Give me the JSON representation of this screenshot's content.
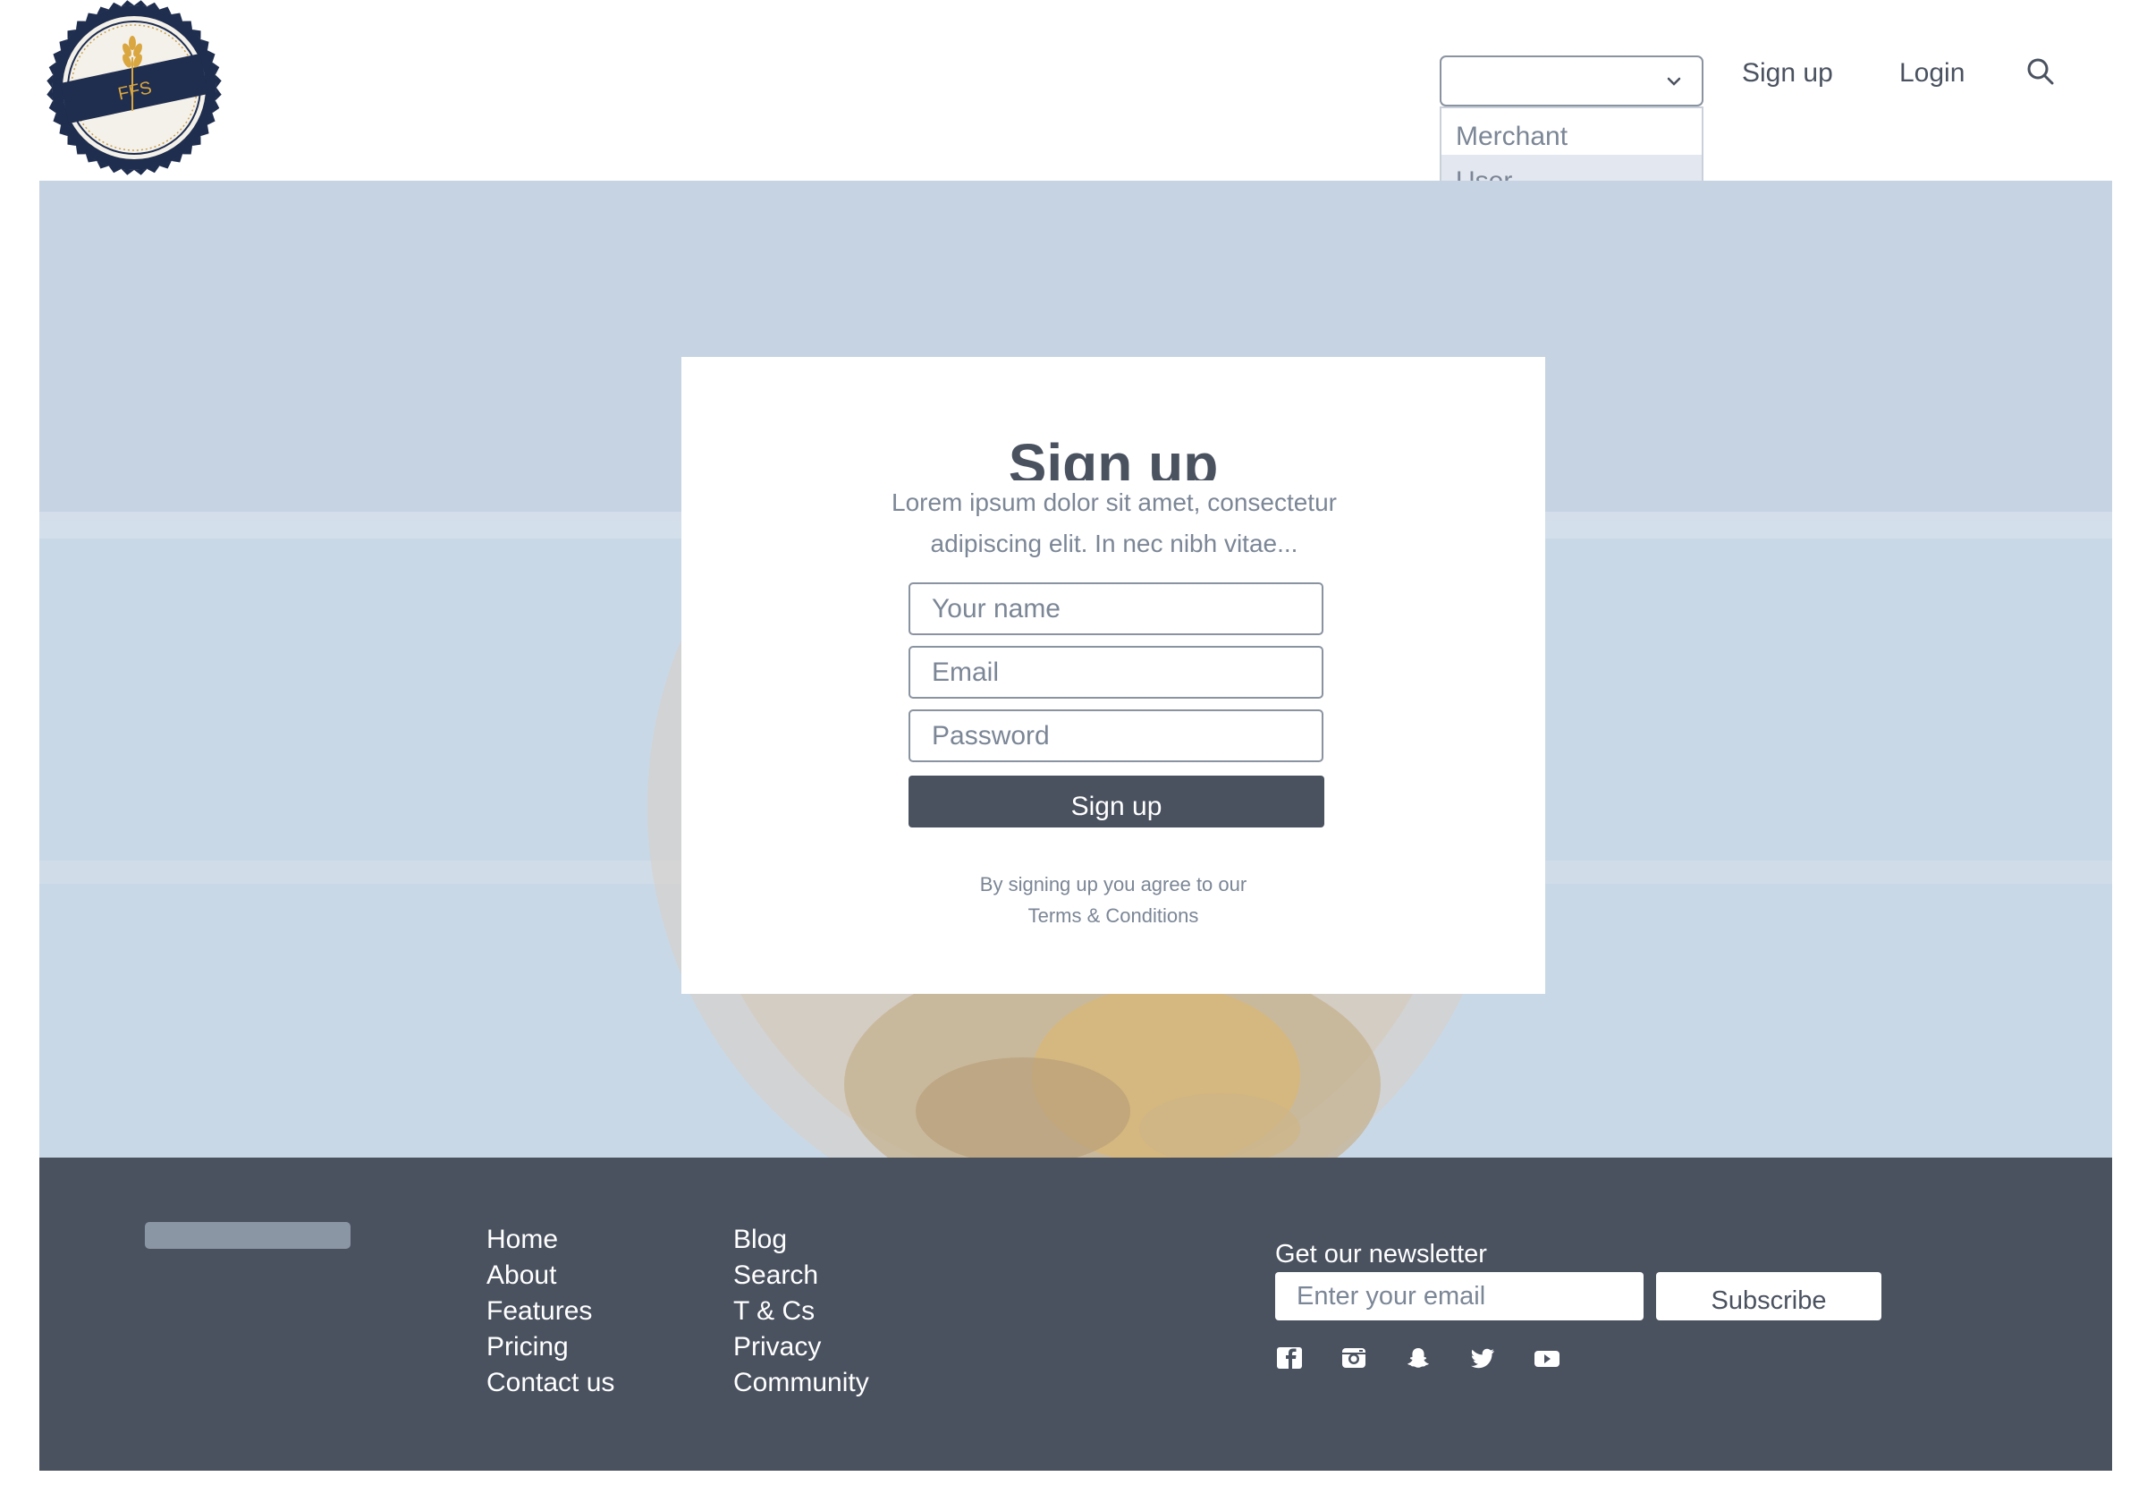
{
  "brand": {
    "logo_text": "FFS"
  },
  "header": {
    "role_select": {
      "value": "",
      "options": [
        "Merchant",
        "User"
      ]
    },
    "nav": {
      "signup": "Sign up",
      "login": "Login"
    }
  },
  "card": {
    "title": "Sign up",
    "subtitle": "Lorem ipsum dolor sit amet, consectetur adipiscing elit. In nec nibh vitae...",
    "fields": {
      "name_placeholder": "Your name",
      "email_placeholder": "Email",
      "password_placeholder": "Password"
    },
    "button": "Sign up",
    "legal_text": "By signing up you agree to our",
    "legal_link": "Terms & Conditions"
  },
  "footer": {
    "links_col1": [
      "Home",
      "About",
      "Features",
      "Pricing",
      "Contact us"
    ],
    "links_col2": [
      "Blog",
      "Search",
      "T & Cs",
      "Privacy",
      "Community"
    ],
    "newsletter": {
      "label": "Get our newsletter",
      "placeholder": "Enter your email",
      "button": "Subscribe"
    },
    "social": [
      "facebook-icon",
      "instagram-icon",
      "snapchat-icon",
      "twitter-icon",
      "youtube-icon"
    ]
  },
  "colors": {
    "primary": "#4a5260",
    "hero_bg": "#c8d6e4",
    "muted_text": "#7b8696",
    "logo_navy": "#1f2d4e",
    "logo_gold": "#d9a640"
  }
}
